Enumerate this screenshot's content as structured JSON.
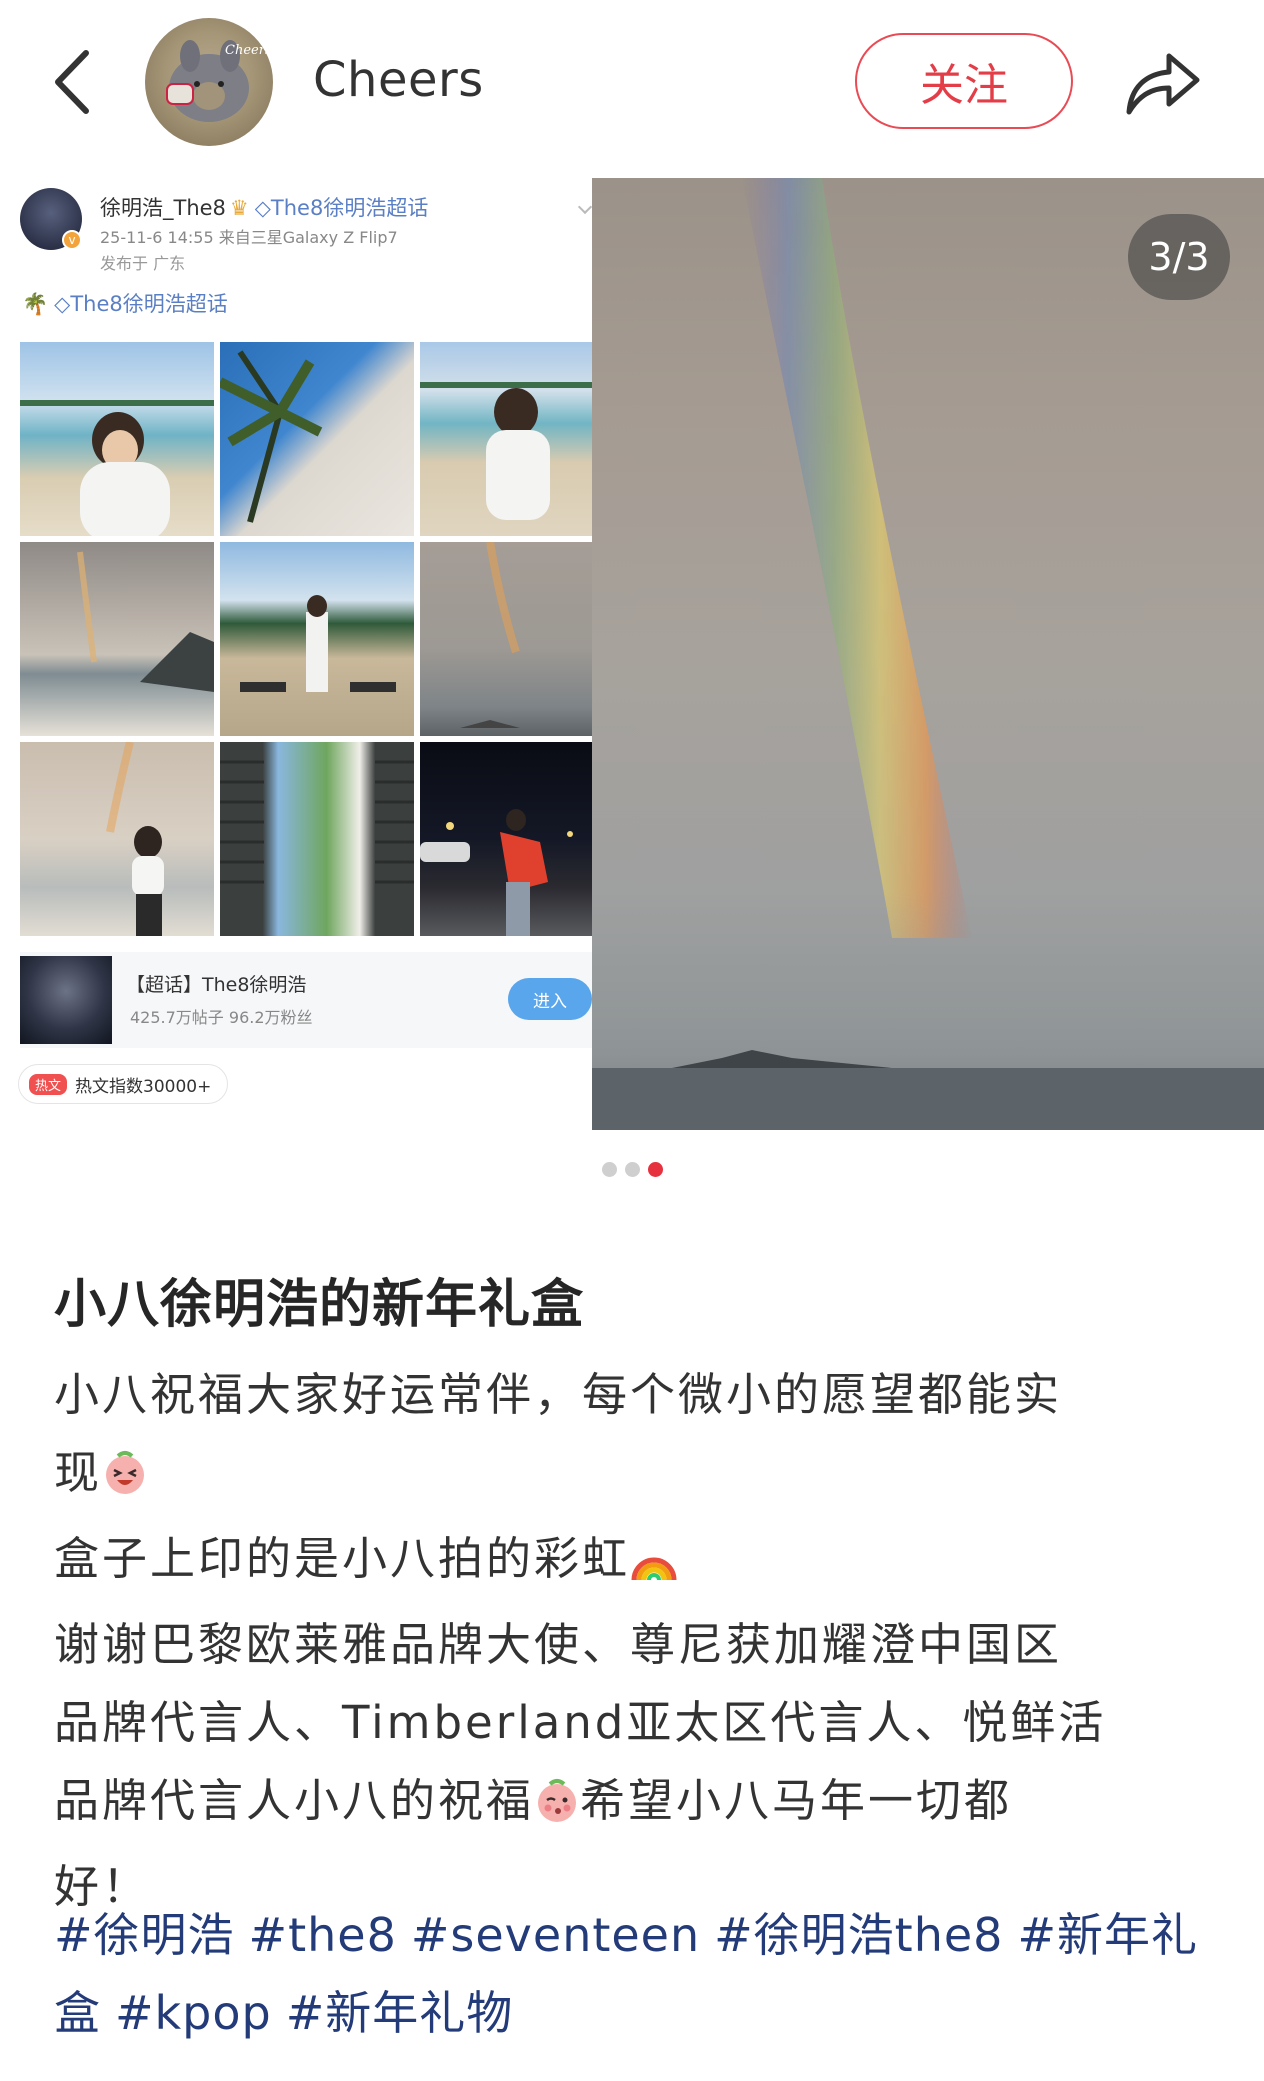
{
  "header": {
    "author_name": "Cheers",
    "follow_label": "关注",
    "avatar_text": "Cheers"
  },
  "carousel": {
    "counter": "3/3",
    "total": 3,
    "active_index": 3
  },
  "embedded_post": {
    "author": "徐明浩_The8",
    "topic": "The8徐明浩超话",
    "meta": "25-11-6 14:55  来自三星Galaxy Z Flip7",
    "location": "发布于 广东",
    "supertopic": "The8徐明浩超话",
    "card": {
      "title": "【超话】The8徐明浩",
      "subtitle": "425.7万帖子 96.2万粉丝",
      "enter_label": "进入"
    },
    "hot": {
      "tag": "热文",
      "text": "热文指数30000+"
    }
  },
  "post": {
    "title": "小八徐明浩的新年礼盒",
    "lines": [
      "小八祝福大家好运常伴，每个微小的愿望都能实",
      "现",
      "盒子上印的是小八拍的彩虹",
      "谢谢巴黎欧莱雅品牌大使、尊尼获加耀澄中国区",
      "品牌代言人、Timberland亚太区代言人、悦鲜活",
      "品牌代言人小八的祝福",
      "希望小八马年一切都",
      "好！"
    ],
    "hashtags": [
      "#徐明浩",
      "#the8",
      "#seventeen",
      "#徐明浩the8",
      "#新年礼",
      "盒",
      "#kpop",
      "#新年礼物"
    ]
  },
  "colors": {
    "accent": "#e94b55",
    "hashtag": "#233b78",
    "dot_active": "#e6323f",
    "dot_inactive": "#cfcfcf"
  },
  "icons": [
    "back-arrow-icon",
    "share-icon",
    "emoji-laugh-icon",
    "emoji-rainbow-icon",
    "emoji-blush-icon"
  ]
}
